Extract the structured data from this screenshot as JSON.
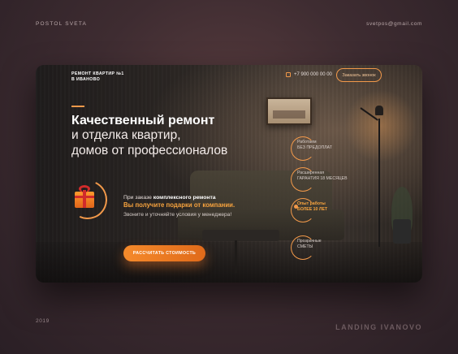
{
  "corner": {
    "top_left": "POSTOL SVETA",
    "top_right": "svetpos@gmail.com",
    "bottom_left": "2019",
    "bottom_right": "LANDING IVANOVO"
  },
  "header": {
    "brand_line1": "РЕМОНТ КВАРТИР №1",
    "brand_line2": "В ИВАНОВО",
    "phone": "+7 900 000 00 00",
    "call_button": "Заказать звонок"
  },
  "hero": {
    "title_bold": "Качественный ремонт",
    "title_rest_1": "и отделка квартир,",
    "title_rest_2": "домов от профессионалов"
  },
  "promo": {
    "line1_prefix": "При заказе ",
    "line1_bold": "комплексного ремонта",
    "line2": "Вы получите подарки от компании.",
    "line3": "Звоните и уточняйте условия у менеджера!"
  },
  "cta": {
    "label": "РАССЧИТАТЬ СТОИМОСТЬ"
  },
  "features": [
    {
      "line1": "Работаем",
      "line2": "БЕЗ ПРЕДОПЛАТ"
    },
    {
      "line1": "Расширенная",
      "line2": "ГАРАНТИЯ 18 МЕСЯЦЕВ"
    },
    {
      "line1": "Опыт работы",
      "line2": "БОЛЕЕ 10 ЛЕТ"
    },
    {
      "line1": "Прозрачные",
      "line2": "СМЕТЫ"
    }
  ],
  "colors": {
    "accent": "#f2994a",
    "highlight": "#f7a33e"
  },
  "icons": {
    "phone": "phone-icon",
    "gift": "gift-icon"
  }
}
